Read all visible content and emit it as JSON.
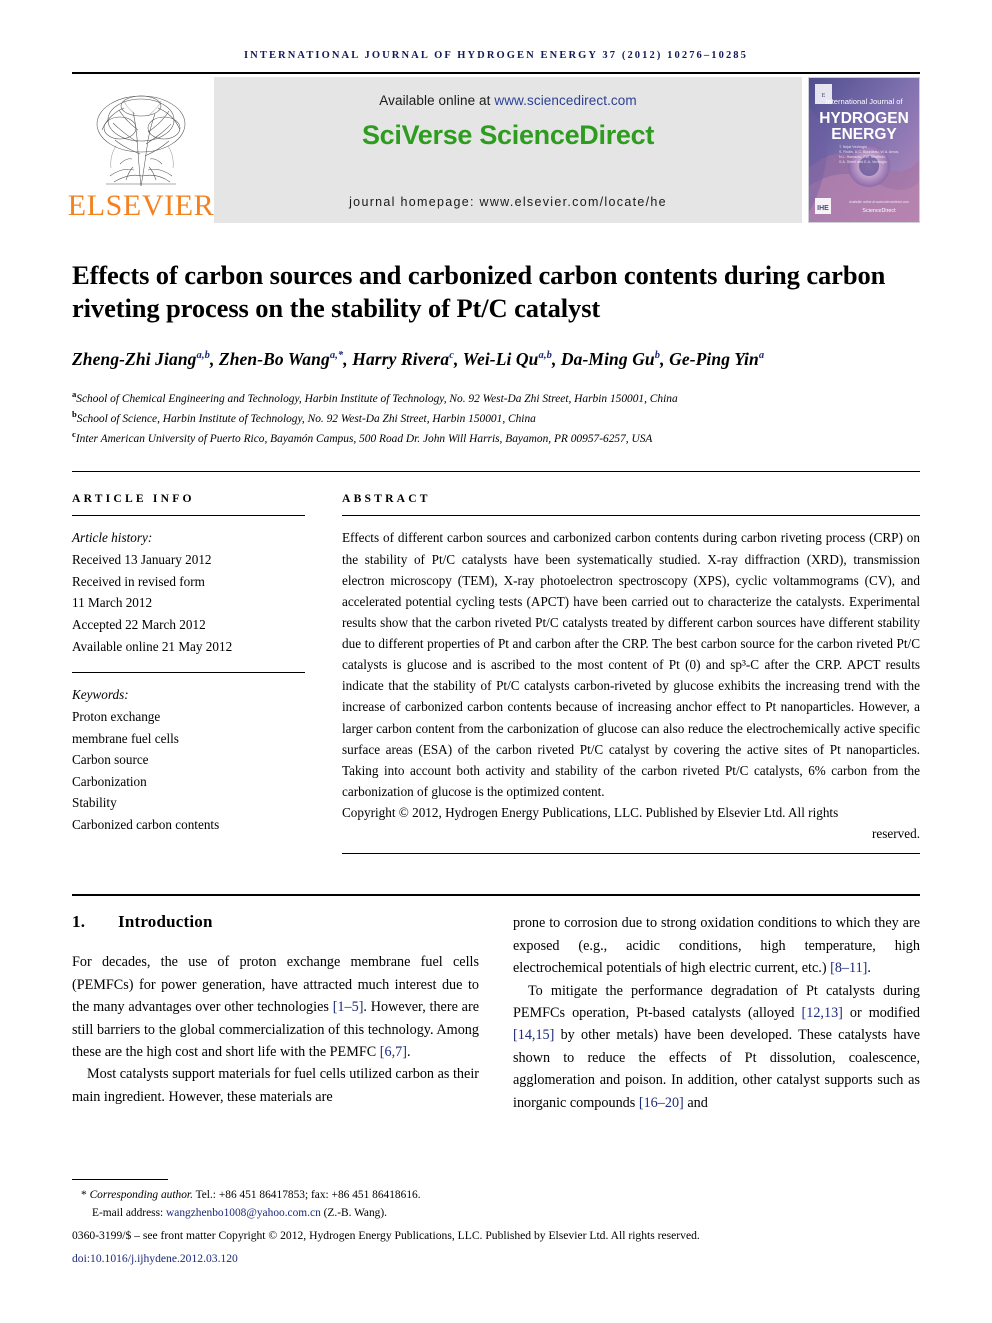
{
  "running_head": "International Journal of Hydrogen Energy 37 (2012) 10276–10285",
  "masthead": {
    "publisher_name": "ELSEVIER",
    "available_prefix": "Available online at ",
    "available_url": "www.sciencedirect.com",
    "platform_logo": "SciVerse ScienceDirect",
    "homepage": "journal homepage: www.elsevier.com/locate/he",
    "cover": {
      "line1": "International Journal of",
      "line2": "HYDROGEN",
      "line3": "ENERGY",
      "badge": "ScienceDirect"
    }
  },
  "article": {
    "title": "Effects of carbon sources and carbonized carbon contents during carbon riveting process on the stability of Pt/C catalyst",
    "authors_html": "Zheng-Zhi Jiang<sup>a,b</sup>, Zhen-Bo Wang<sup>a,*</sup>, Harry Rivera<sup>c</sup>, Wei-Li Qu<sup>a,b</sup>, Da-Ming Gu<sup>b</sup>, Ge-Ping Yin<sup>a</sup>",
    "affiliations": [
      {
        "mark": "a",
        "text": "School of Chemical Engineering and Technology, Harbin Institute of Technology, No. 92 West-Da Zhi Street, Harbin 150001, China"
      },
      {
        "mark": "b",
        "text": "School of Science, Harbin Institute of Technology, No. 92 West-Da Zhi Street, Harbin 150001, China"
      },
      {
        "mark": "c",
        "text": "Inter American University of Puerto Rico, Bayamón Campus, 500 Road Dr. John Will Harris, Bayamon, PR 00957-6257, USA"
      }
    ]
  },
  "article_info": {
    "heading": "Article info",
    "history_label": "Article history:",
    "history": [
      "Received 13 January 2012",
      "Received in revised form",
      "11 March 2012",
      "Accepted 22 March 2012",
      "Available online 21 May 2012"
    ],
    "keywords_label": "Keywords:",
    "keywords": [
      "Proton exchange",
      "membrane fuel cells",
      "Carbon source",
      "Carbonization",
      "Stability",
      "Carbonized carbon contents"
    ]
  },
  "abstract": {
    "heading": "Abstract",
    "text": "Effects of different carbon sources and carbonized carbon contents during carbon riveting process (CRP) on the stability of Pt/C catalysts have been systematically studied. X-ray diffraction (XRD), transmission electron microscopy (TEM), X-ray photoelectron spectroscopy (XPS), cyclic voltammograms (CV), and accelerated potential cycling tests (APCT) have been carried out to characterize the catalysts. Experimental results show that the carbon riveted Pt/C catalysts treated by different carbon sources have different stability due to different properties of Pt and carbon after the CRP. The best carbon source for the carbon riveted Pt/C catalysts is glucose and is ascribed to the most content of Pt (0) and sp³-C after the CRP. APCT results indicate that the stability of Pt/C catalysts carbon-riveted by glucose exhibits the increasing trend with the increase of carbonized carbon contents because of increasing anchor effect to Pt nanoparticles. However, a larger carbon content from the carbonization of glucose can also reduce the electrochemically active specific surface areas (ESA) of the carbon riveted Pt/C catalyst by covering the active sites of Pt nanoparticles. Taking into account both activity and stability of the carbon riveted Pt/C catalysts, 6% carbon from the carbonization of glucose is the optimized content.",
    "copyright_main": "Copyright © 2012, Hydrogen Energy Publications, LLC. Published by Elsevier Ltd. All rights",
    "copyright_tail": "reserved."
  },
  "body": {
    "section_number": "1.",
    "section_title": "Introduction",
    "left_paragraphs": [
      "For decades, the use of proton exchange membrane fuel cells (PEMFCs) for power generation, have attracted much interest due to the many advantages over other technologies [1–5]. However, there are still barriers to the global commercialization of this technology. Among these are the high cost and short life with the PEMFC [6,7].",
      "Most catalysts support materials for fuel cells utilized carbon as their main ingredient. However, these materials are"
    ],
    "right_paragraphs": [
      "prone to corrosion due to strong oxidation conditions to which they are exposed (e.g., acidic conditions, high temperature, high electrochemical potentials of high electric current, etc.) [8–11].",
      "To mitigate the performance degradation of Pt catalysts during PEMFCs operation, Pt-based catalysts (alloyed [12,13] or modified [14,15] by other metals) have been developed. These catalysts have shown to reduce the effects of Pt dissolution, coalescence, agglomeration and poison. In addition, other catalyst supports such as inorganic compounds [16–20] and"
    ]
  },
  "footnote": {
    "corresponding_label": "Corresponding author.",
    "corresponding_rest": " Tel.: +86 451 86417853; fax: +86 451 86418616.",
    "email_label": "E-mail address: ",
    "email": "wangzhenbo1008@yahoo.com.cn",
    "email_suffix": " (Z.-B. Wang).",
    "issn_line": "0360-3199/$ – see front matter Copyright © 2012, Hydrogen Energy Publications, LLC. Published by Elsevier Ltd. All rights reserved.",
    "doi_prefix": "doi:",
    "doi": "10.1016/j.ijhydene.2012.03.120"
  },
  "colors": {
    "elsevier_orange": "#f4811f",
    "sciverse_green": "#2e9c1e",
    "link_blue": "#2b3f94",
    "ref_blue": "#1c2a7a",
    "runhead_navy": "#121a56",
    "banner_grey": "#e5e5e5"
  }
}
